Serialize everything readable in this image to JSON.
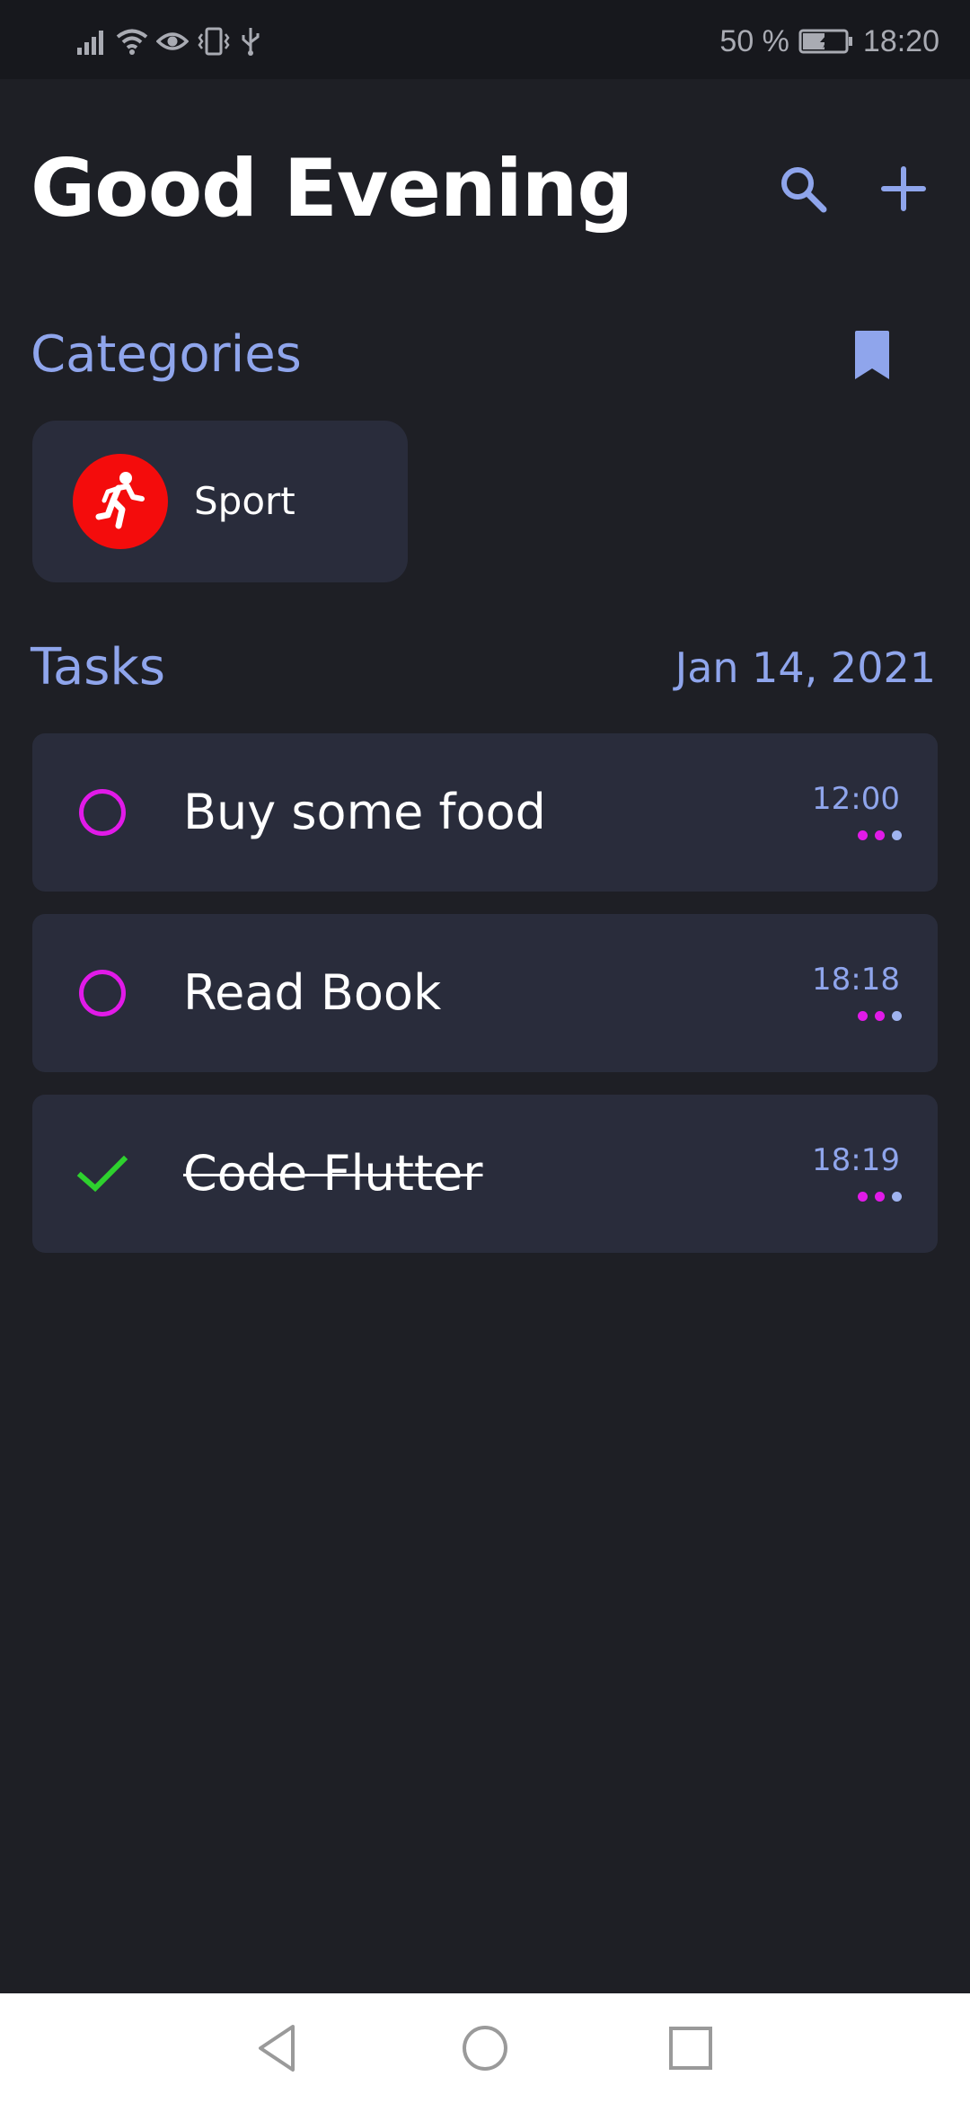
{
  "status_bar": {
    "battery_percent": "50 %",
    "time": "18:20",
    "icons": [
      "signal-icon",
      "wifi-icon",
      "eye-icon",
      "vibrate-icon",
      "usb-icon",
      "battery-charging-icon"
    ]
  },
  "header": {
    "greeting": "Good Evening",
    "icons": [
      "search-icon",
      "plus-icon"
    ]
  },
  "categories": {
    "title": "Categories",
    "action_icon": "bookmark-icon",
    "items": [
      {
        "label": "Sport",
        "icon": "running-person-icon",
        "color": "#f40c0c"
      }
    ]
  },
  "tasks": {
    "title": "Tasks",
    "date": "Jan 14, 2021",
    "items": [
      {
        "title": "Buy some food",
        "time": "12:00",
        "done": false
      },
      {
        "title": "Read Book",
        "time": "18:18",
        "done": false
      },
      {
        "title": "Code Flutter",
        "time": "18:19",
        "done": true
      }
    ]
  },
  "colors": {
    "background": "#1e1f25",
    "card": "#292c3b",
    "accent": "#8fa5ec",
    "ring": "#e11ae8",
    "check": "#2ed12e"
  },
  "nav_bar": {
    "icons": [
      "back-icon",
      "home-icon",
      "recents-icon"
    ]
  }
}
